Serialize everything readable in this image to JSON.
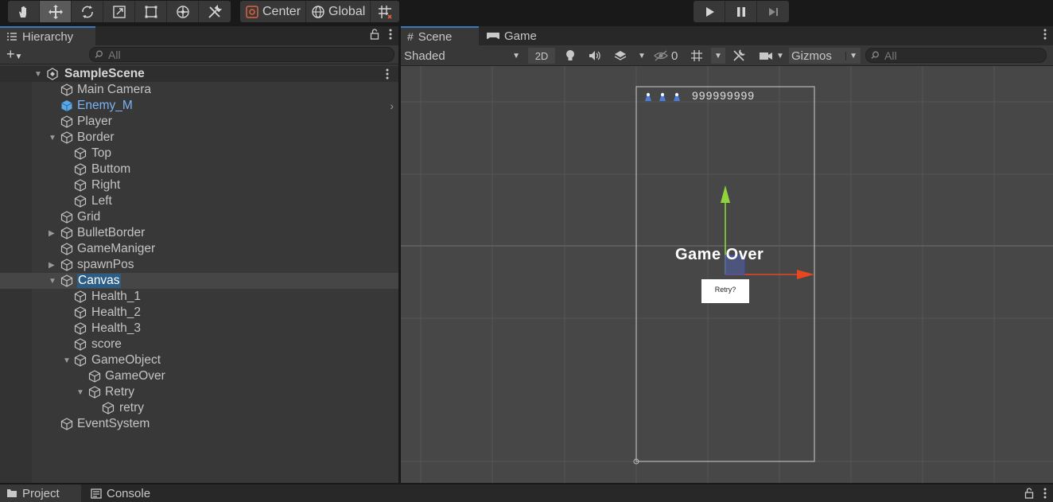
{
  "toolbar": {
    "tools": [
      "hand-tool",
      "move-tool",
      "rotate-tool",
      "scale-tool",
      "rect-tool",
      "transform-tool",
      "custom-tool"
    ],
    "pivot_label": "Center",
    "space_label": "Global",
    "play_controls": [
      "play",
      "pause",
      "step"
    ]
  },
  "hierarchy": {
    "tab_label": "Hierarchy",
    "search_placeholder": "All",
    "scene_name": "SampleScene",
    "items": [
      {
        "label": "Main Camera"
      },
      {
        "label": "Enemy_M"
      },
      {
        "label": "Player"
      },
      {
        "label": "Border"
      },
      {
        "label": "Top"
      },
      {
        "label": "Buttom"
      },
      {
        "label": "Right"
      },
      {
        "label": "Left"
      },
      {
        "label": "Grid"
      },
      {
        "label": "BulletBorder"
      },
      {
        "label": "GameManiger"
      },
      {
        "label": "spawnPos"
      },
      {
        "label": "Canvas"
      },
      {
        "label": "Health_1"
      },
      {
        "label": "Health_2"
      },
      {
        "label": "Health_3"
      },
      {
        "label": "score"
      },
      {
        "label": "GameObject"
      },
      {
        "label": "GameOver"
      },
      {
        "label": "Retry"
      },
      {
        "label": "retry"
      },
      {
        "label": "EventSystem"
      }
    ]
  },
  "scene": {
    "tabs": [
      {
        "label": "Scene"
      },
      {
        "label": "Game"
      }
    ],
    "shading_mode": "Shaded",
    "mode_2d": "2D",
    "hidden_count": "0",
    "gizmos_label": "Gizmos",
    "search_placeholder": "All",
    "score_text": "999999999",
    "game_over_text": "Game Over",
    "retry_button_text": "Retry?"
  },
  "bottom": {
    "tabs": [
      {
        "label": "Project"
      },
      {
        "label": "Console"
      }
    ]
  },
  "colors": {
    "selection": "#2c5d87",
    "prefab_text": "#7ab4f2",
    "active_tab_accent": "#3a79bb",
    "gizmo_y": "#8ed43a",
    "gizmo_x": "#e8461e"
  }
}
